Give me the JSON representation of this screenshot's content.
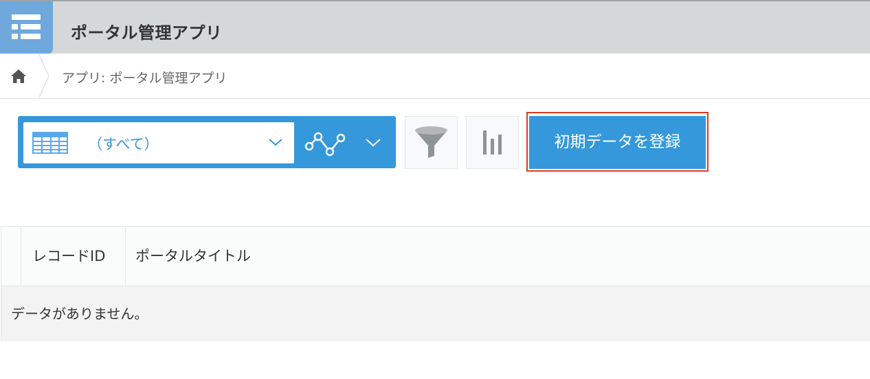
{
  "header": {
    "app_title": "ポータル管理アプリ",
    "app_icon": "list-icon"
  },
  "breadcrumb": {
    "home_icon": "home-icon",
    "current": "アプリ: ポータル管理アプリ"
  },
  "toolbar": {
    "view_select_value": "（すべて）",
    "view_icon": "table-icon",
    "graph_icon": "line-graph-icon",
    "filter_icon": "filter-icon",
    "chart_icon": "bar-chart-icon",
    "register_label": "初期データを登録"
  },
  "table": {
    "columns": [
      "レコードID",
      "ポータルタイトル"
    ],
    "empty_message": "データがありません。"
  },
  "colors": {
    "accent": "#3498db",
    "header_bg": "#d5d8d9",
    "highlight_outline": "#e03a1e"
  }
}
